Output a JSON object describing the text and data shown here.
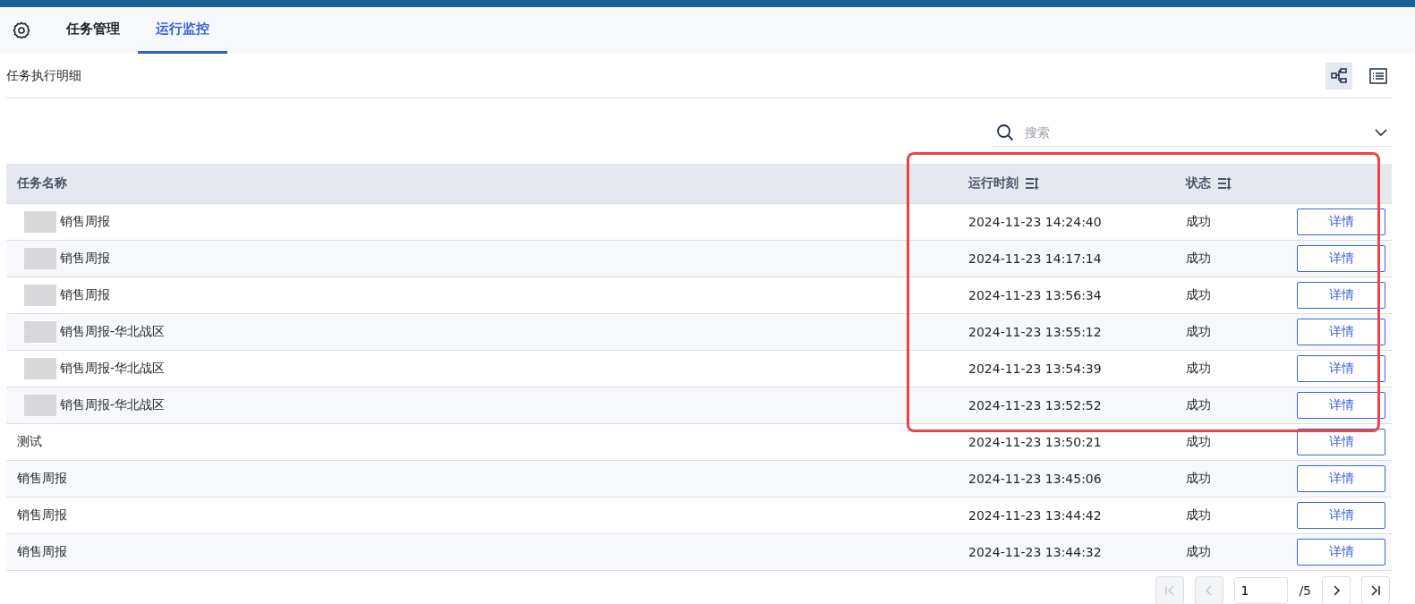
{
  "tabs": [
    {
      "label": "任务管理",
      "selected": false
    },
    {
      "label": "运行监控",
      "selected": true
    }
  ],
  "section_title": "任务执行明细",
  "view_toggles": [
    {
      "kind": "tree",
      "selected": true
    },
    {
      "kind": "list",
      "selected": false
    }
  ],
  "search": {
    "placeholder": "搜索"
  },
  "table": {
    "columns": [
      {
        "label": "任务名称",
        "sortable": false
      },
      {
        "label": "运行时刻",
        "sortable": true
      },
      {
        "label": "状态",
        "sortable": true
      }
    ],
    "rows": [
      {
        "name": "销售周报",
        "redacted": true,
        "time": "2024-11-23 14:24:40",
        "status": "成功",
        "action": "详情"
      },
      {
        "name": "销售周报",
        "redacted": true,
        "time": "2024-11-23 14:17:14",
        "status": "成功",
        "action": "详情"
      },
      {
        "name": "销售周报",
        "redacted": true,
        "time": "2024-11-23 13:56:34",
        "status": "成功",
        "action": "详情"
      },
      {
        "name": "销售周报-华北战区",
        "redacted": true,
        "time": "2024-11-23 13:55:12",
        "status": "成功",
        "action": "详情"
      },
      {
        "name": "销售周报-华北战区",
        "redacted": true,
        "time": "2024-11-23 13:54:39",
        "status": "成功",
        "action": "详情"
      },
      {
        "name": "销售周报-华北战区",
        "redacted": true,
        "time": "2024-11-23 13:52:52",
        "status": "成功",
        "action": "详情"
      },
      {
        "name": "测试",
        "redacted": false,
        "time": "2024-11-23 13:50:21",
        "status": "成功",
        "action": "详情"
      },
      {
        "name": "销售周报",
        "redacted": false,
        "time": "2024-11-23 13:45:06",
        "status": "成功",
        "action": "详情"
      },
      {
        "name": "销售周报",
        "redacted": false,
        "time": "2024-11-23 13:44:42",
        "status": "成功",
        "action": "详情"
      },
      {
        "name": "销售周报",
        "redacted": false,
        "time": "2024-11-23 13:44:32",
        "status": "成功",
        "action": "详情"
      }
    ]
  },
  "annotation": {
    "kind": "highlight-box"
  },
  "pagination": {
    "page": "1",
    "total": "/5",
    "first_disabled": true,
    "prev_disabled": true
  }
}
